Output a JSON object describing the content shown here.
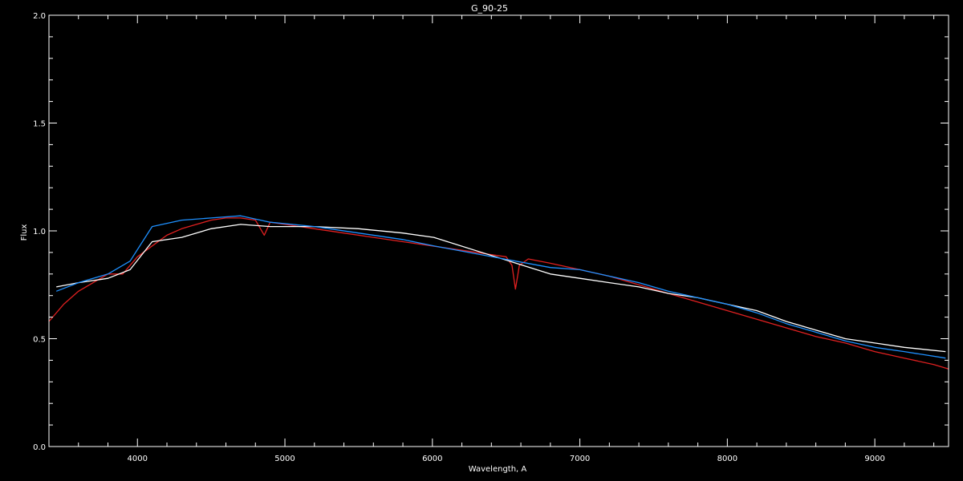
{
  "chart_data": {
    "type": "line",
    "title": "G_90-25",
    "xlabel": "Wavelength, A",
    "ylabel": "Flux",
    "xlim": [
      3400,
      9500
    ],
    "ylim": [
      0.0,
      2.0
    ],
    "x_ticks": [
      4000,
      5000,
      6000,
      7000,
      8000,
      9000
    ],
    "x_tick_labels": [
      "4000",
      "5000",
      "6000",
      "7000",
      "8000",
      "9000"
    ],
    "y_ticks": [
      0.0,
      0.5,
      1.0,
      1.5,
      2.0
    ],
    "y_tick_labels": [
      "0.0",
      "0.5",
      "1.0",
      "1.5",
      "2.0"
    ],
    "grid": false,
    "colors": {
      "background": "#000000",
      "axes": "#ffffff",
      "observed": "#ffffff",
      "model": "#e02020",
      "fit": "#1e90ff"
    },
    "series": [
      {
        "color_key": "model",
        "x": [
          3400,
          3500,
          3600,
          3700,
          3800,
          3900,
          4000,
          4100,
          4200,
          4300,
          4400,
          4500,
          4600,
          4700,
          4800,
          4860,
          4900,
          5000,
          5200,
          5400,
          5600,
          5800,
          6000,
          6200,
          6400,
          6500,
          6540,
          6563,
          6590,
          6650,
          6800,
          7000,
          7200,
          7400,
          7600,
          7800,
          8000,
          8200,
          8400,
          8600,
          8800,
          9000,
          9200,
          9400,
          9500
        ],
        "values": [
          0.58,
          0.66,
          0.72,
          0.76,
          0.8,
          0.8,
          0.88,
          0.93,
          0.98,
          1.01,
          1.03,
          1.05,
          1.06,
          1.06,
          1.05,
          0.98,
          1.04,
          1.03,
          1.01,
          0.99,
          0.97,
          0.95,
          0.93,
          0.91,
          0.89,
          0.88,
          0.84,
          0.73,
          0.84,
          0.87,
          0.85,
          0.82,
          0.79,
          0.75,
          0.71,
          0.67,
          0.63,
          0.59,
          0.55,
          0.51,
          0.48,
          0.44,
          0.41,
          0.38,
          0.36
        ]
      },
      {
        "color_key": "observed",
        "x": [
          3450,
          3600,
          3800,
          3950,
          4100,
          4300,
          4500,
          4700,
          4900,
          5200,
          5500,
          5800,
          6010,
          6800,
          7000,
          7200,
          7400,
          7600,
          7800,
          8000,
          8200,
          8400,
          8600,
          8800,
          9000,
          9200,
          9480
        ],
        "values": [
          0.74,
          0.76,
          0.78,
          0.82,
          0.95,
          0.97,
          1.01,
          1.03,
          1.02,
          1.02,
          1.01,
          0.99,
          0.97,
          0.8,
          0.78,
          0.76,
          0.74,
          0.71,
          0.69,
          0.66,
          0.63,
          0.58,
          0.54,
          0.5,
          0.48,
          0.46,
          0.44
        ]
      },
      {
        "color_key": "fit",
        "x": [
          3450,
          3600,
          3800,
          3950,
          4100,
          4300,
          4500,
          4700,
          4900,
          5200,
          5500,
          5800,
          6010,
          6800,
          7000,
          7200,
          7400,
          7600,
          7800,
          8000,
          8200,
          8400,
          8600,
          8800,
          9000,
          9200,
          9480
        ],
        "values": [
          0.72,
          0.76,
          0.8,
          0.86,
          1.02,
          1.05,
          1.06,
          1.07,
          1.04,
          1.02,
          0.99,
          0.96,
          0.93,
          0.83,
          0.82,
          0.79,
          0.76,
          0.72,
          0.69,
          0.66,
          0.62,
          0.57,
          0.53,
          0.49,
          0.46,
          0.44,
          0.41
        ]
      }
    ]
  }
}
